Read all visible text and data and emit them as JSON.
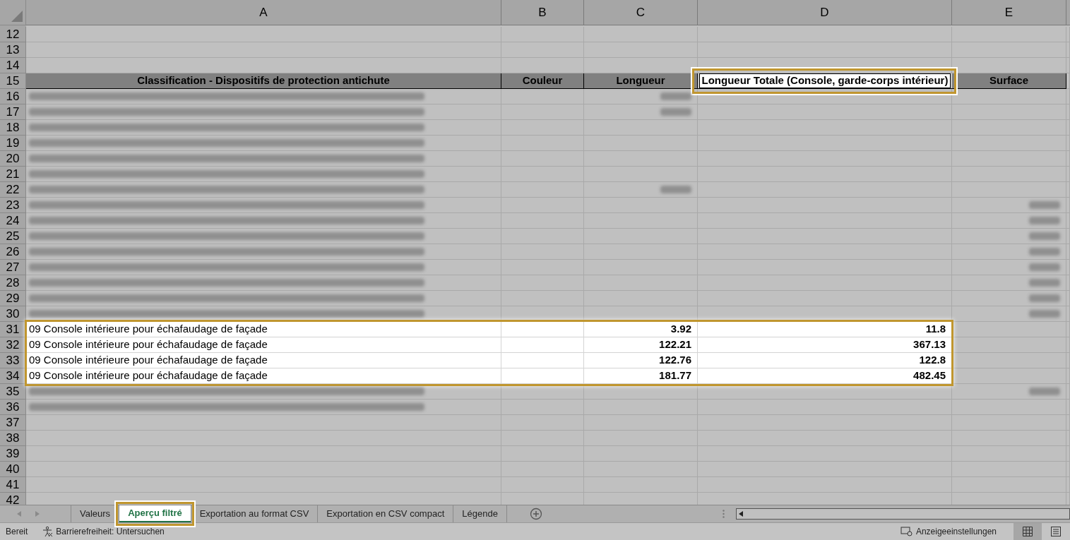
{
  "columns": [
    "A",
    "B",
    "C",
    "D",
    "E"
  ],
  "rows": [
    {
      "kind": "empty",
      "number": "12"
    },
    {
      "kind": "empty",
      "number": "13"
    },
    {
      "kind": "empty",
      "number": "14"
    },
    {
      "kind": "header",
      "number": "15",
      "cells": [
        {
          "text": "Classification - Dispositifs de protection antichute",
          "highlighted": false
        },
        {
          "text": "Couleur",
          "highlighted": false
        },
        {
          "text": "Longueur",
          "highlighted": false
        },
        {
          "text": "Longueur Totale (Console, garde-corps intérieur)",
          "highlighted": true
        },
        {
          "text": "Surface",
          "highlighted": false
        }
      ]
    },
    {
      "kind": "blurred",
      "number": "16",
      "blurred_cells": [
        true,
        false,
        true,
        false,
        false
      ]
    },
    {
      "kind": "blurred",
      "number": "17",
      "blurred_cells": [
        true,
        false,
        true,
        false,
        false
      ]
    },
    {
      "kind": "blurred",
      "number": "18",
      "blurred_cells": [
        true,
        false,
        false,
        false,
        false
      ]
    },
    {
      "kind": "blurred",
      "number": "19",
      "blurred_cells": [
        true,
        false,
        false,
        false,
        false
      ]
    },
    {
      "kind": "blurred",
      "number": "20",
      "blurred_cells": [
        true,
        false,
        false,
        false,
        false
      ]
    },
    {
      "kind": "blurred",
      "number": "21",
      "blurred_cells": [
        true,
        false,
        false,
        false,
        false
      ]
    },
    {
      "kind": "blurred",
      "number": "22",
      "blurred_cells": [
        true,
        false,
        true,
        false,
        false
      ]
    },
    {
      "kind": "blurred",
      "number": "23",
      "blurred_cells": [
        true,
        false,
        false,
        false,
        true
      ]
    },
    {
      "kind": "blurred",
      "number": "24",
      "blurred_cells": [
        true,
        false,
        false,
        false,
        true
      ]
    },
    {
      "kind": "blurred",
      "number": "25",
      "blurred_cells": [
        true,
        false,
        false,
        false,
        true
      ]
    },
    {
      "kind": "blurred",
      "number": "26",
      "blurred_cells": [
        true,
        false,
        false,
        false,
        true
      ]
    },
    {
      "kind": "blurred",
      "number": "27",
      "blurred_cells": [
        true,
        false,
        false,
        false,
        true
      ]
    },
    {
      "kind": "blurred",
      "number": "28",
      "blurred_cells": [
        true,
        false,
        false,
        false,
        true
      ]
    },
    {
      "kind": "blurred",
      "number": "29",
      "blurred_cells": [
        true,
        false,
        false,
        false,
        true
      ]
    },
    {
      "kind": "blurred",
      "number": "30",
      "blurred_cells": [
        true,
        false,
        false,
        false,
        true
      ]
    },
    {
      "kind": "data",
      "number": "31",
      "highlighted": true,
      "classification": "09 Console intérieure pour échafaudage de façade",
      "longueur": "3.92",
      "longueur_totale": "11.8"
    },
    {
      "kind": "data",
      "number": "32",
      "highlighted": true,
      "classification": "09 Console intérieure pour échafaudage de façade",
      "longueur": "122.21",
      "longueur_totale": "367.13"
    },
    {
      "kind": "data",
      "number": "33",
      "highlighted": true,
      "classification": "09 Console intérieure pour échafaudage de façade",
      "longueur": "122.76",
      "longueur_totale": "122.8"
    },
    {
      "kind": "data",
      "number": "34",
      "highlighted": true,
      "classification": "09 Console intérieure pour échafaudage de façade",
      "longueur": "181.77",
      "longueur_totale": "482.45"
    },
    {
      "kind": "blurred",
      "number": "35",
      "blurred_cells": [
        true,
        false,
        false,
        false,
        true
      ]
    },
    {
      "kind": "blurred",
      "number": "36",
      "blurred_cells": [
        true,
        false,
        false,
        false,
        false
      ]
    },
    {
      "kind": "empty",
      "number": "37"
    },
    {
      "kind": "empty",
      "number": "38"
    },
    {
      "kind": "empty",
      "number": "39"
    },
    {
      "kind": "empty",
      "number": "40"
    },
    {
      "kind": "empty",
      "number": "41"
    },
    {
      "kind": "empty",
      "number": "42"
    }
  ],
  "sheet_tabs": [
    {
      "label": "Valeurs",
      "selected": false,
      "highlighted": false
    },
    {
      "label": "Aperçu filtré",
      "selected": true,
      "highlighted": true
    },
    {
      "label": "Exportation au format CSV",
      "selected": false,
      "highlighted": false
    },
    {
      "label": "Exportation en CSV compact",
      "selected": false,
      "highlighted": false
    },
    {
      "label": "Légende",
      "selected": false,
      "highlighted": false
    }
  ],
  "status_bar": {
    "mode": "Bereit",
    "accessibility": "Barrierefreiheit: Untersuchen",
    "display_settings": "Anzeigeeinstellungen"
  }
}
